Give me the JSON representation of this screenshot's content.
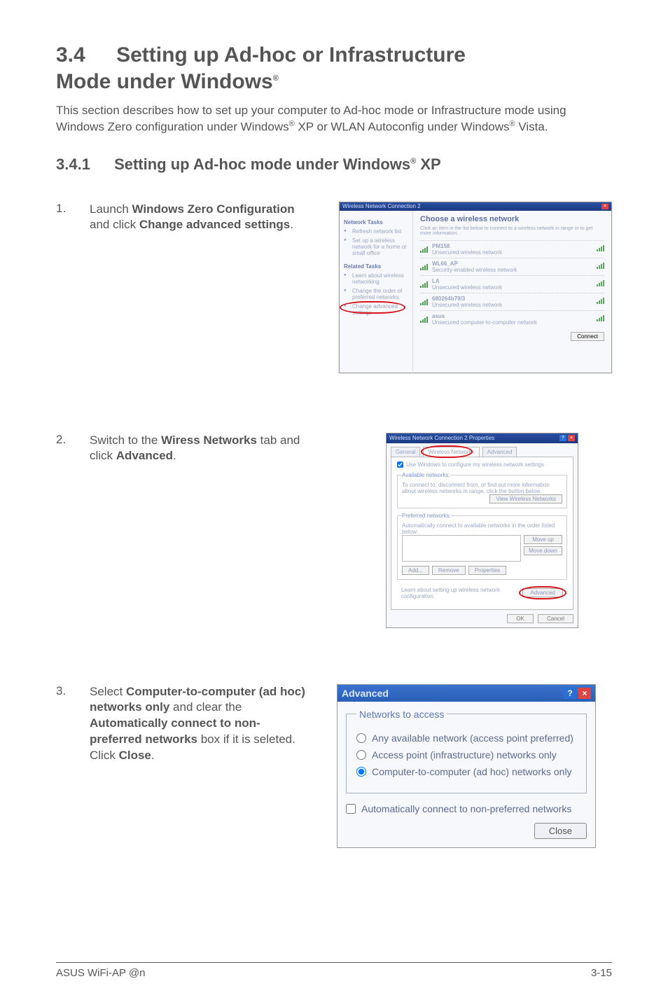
{
  "section": {
    "number": "3.4",
    "title_line1": "Setting up Ad-hoc or Infrastructure",
    "title_line2": "Mode under Windows",
    "reg": "®"
  },
  "intro": {
    "pre": "This section describes how to set up your computer to Ad-hoc mode or Infrastructure mode using Windows Zero configuration under Windows",
    "reg1": "®",
    "mid": " XP or WLAN Autoconfig under Windows",
    "reg2": "®",
    "end": " Vista."
  },
  "sub": {
    "number": "3.4.1",
    "title_pre": "Setting up Ad-hoc mode under Windows",
    "reg": "®",
    "title_post": " XP"
  },
  "step1": {
    "num": "1.",
    "t1": "Launch ",
    "b1": "Windows Zero Configuration",
    "t2": " and click ",
    "b2": "Change advanced settings",
    "t3": "."
  },
  "dlg1": {
    "title": "Wireless Network Connection 2",
    "heading": "Choose a wireless network",
    "hint": "Click an item in the list below to connect to a wireless network in range or to get more information.",
    "side": {
      "group1": "Network Tasks",
      "link1": "Refresh network list",
      "link2": "Set up a wireless network for a home or small office",
      "group2": "Related Tasks",
      "link3": "Learn about wireless networking",
      "link4": "Change the order of preferred networks",
      "link5": "Change advanced settings"
    },
    "net1_name": "PM158",
    "net1_sub": "Unsecured wireless network",
    "net2_name": "WL66_AP",
    "net2_sub": "Security-enabled wireless network",
    "net3_name": "LA",
    "net3_sub": "Unsecured wireless network",
    "net4_name": "680264b79/3",
    "net4_sub": "Unsecured wireless network",
    "net5_name": "asus",
    "net5_sub": "Unsecured computer-to-computer network",
    "connect": "Connect"
  },
  "step2": {
    "num": "2.",
    "t1": "Switch to the ",
    "b1": "Wiress Networks",
    "t2": " tab and click ",
    "b2": "Advanced",
    "t3": "."
  },
  "dlg2": {
    "title": "Wireless Network Connection 2 Properties",
    "tab1": "General",
    "tab2": "Wireless Networks",
    "tab3": "Advanced",
    "cb1": "Use Windows to configure my wireless network settings",
    "legend1": "Available networks:",
    "avail_text": "To connect to, disconnect from, or find out more information about wireless networks in range, click the button below.",
    "btn_view": "View Wireless Networks",
    "legend2": "Preferred networks:",
    "pref_text": "Automatically connect to available networks in the order listed below:",
    "btn_up": "Move up",
    "btn_down": "Move down",
    "btn_add": "Add...",
    "btn_remove": "Remove",
    "btn_props": "Properties",
    "link": "Learn about setting up wireless network configuration.",
    "btn_adv": "Advanced",
    "btn_ok": "OK",
    "btn_cancel": "Cancel"
  },
  "step3": {
    "num": "3.",
    "t1": "Select ",
    "b1": "Computer-to-computer (ad hoc) networks only",
    "t2": " and clear the ",
    "b2": "Automatically connect to non-preferred networks",
    "t3": " box if it is seleted. Click ",
    "b3": "Close",
    "t4": "."
  },
  "dlg3": {
    "title": "Advanced",
    "legend": "Networks to access",
    "opt1": "Any available network (access point preferred)",
    "opt2": "Access point (infrastructure) networks only",
    "opt3": "Computer-to-computer (ad hoc) networks only",
    "cb": "Automatically connect to non-preferred networks",
    "close": "Close"
  },
  "footer": {
    "left": "ASUS WiFi-AP @n",
    "right": "3-15"
  }
}
